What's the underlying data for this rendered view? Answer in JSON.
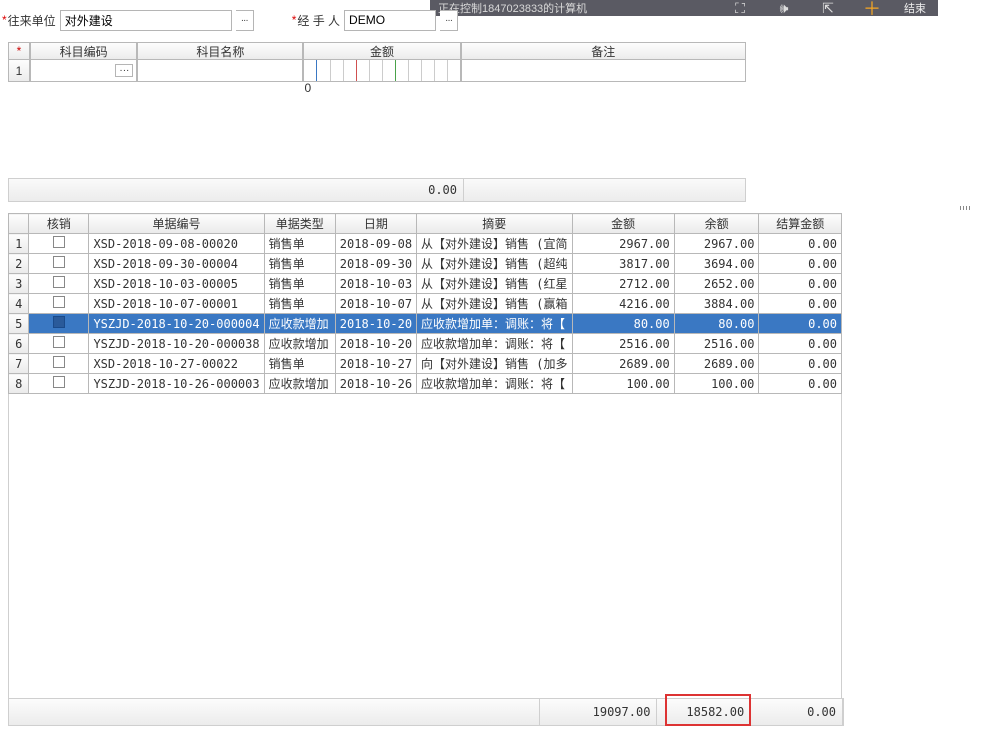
{
  "remote": {
    "title": "正在控制1847023833的计算机",
    "end_label": "结束"
  },
  "form": {
    "party_label": "往来单位",
    "party_value": "对外建设",
    "handler_label": "经 手 人",
    "handler_value": "DEMO"
  },
  "upper": {
    "headers": {
      "code": "科目编码",
      "name": "科目名称",
      "amount": "金额",
      "remark": "备注"
    },
    "row1_amount": "0",
    "footer_amount": "0.00"
  },
  "grid": {
    "headers": {
      "hx": "核销",
      "docno": "单据编号",
      "doctype": "单据类型",
      "date": "日期",
      "digest": "摘要",
      "amount": "金额",
      "balance": "余额",
      "settle": "结算金额"
    },
    "rows": [
      {
        "idx": "1",
        "doc": "XSD-2018-09-08-00020",
        "type": "销售单",
        "date": "2018-09-08",
        "digest": "从【对外建设】销售 (宜简",
        "amt": "2967.00",
        "bal": "2967.00",
        "settle": "0.00"
      },
      {
        "idx": "2",
        "doc": "XSD-2018-09-30-00004",
        "type": "销售单",
        "date": "2018-09-30",
        "digest": "从【对外建设】销售 (超纯",
        "amt": "3817.00",
        "bal": "3694.00",
        "settle": "0.00"
      },
      {
        "idx": "3",
        "doc": "XSD-2018-10-03-00005",
        "type": "销售单",
        "date": "2018-10-03",
        "digest": "从【对外建设】销售 (红星",
        "amt": "2712.00",
        "bal": "2652.00",
        "settle": "0.00"
      },
      {
        "idx": "4",
        "doc": "XSD-2018-10-07-00001",
        "type": "销售单",
        "date": "2018-10-07",
        "digest": "从【对外建设】销售 (赢箱",
        "amt": "4216.00",
        "bal": "3884.00",
        "settle": "0.00"
      },
      {
        "idx": "5",
        "doc": "YSZJD-2018-10-20-000004",
        "type": "应收款增加",
        "date": "2018-10-20",
        "digest": "应收款增加单：调账：将【",
        "amt": "80.00",
        "bal": "80.00",
        "settle": "0.00",
        "selected": true
      },
      {
        "idx": "6",
        "doc": "YSZJD-2018-10-20-000038",
        "type": "应收款增加",
        "date": "2018-10-20",
        "digest": "应收款增加单：调账：将【",
        "amt": "2516.00",
        "bal": "2516.00",
        "settle": "0.00"
      },
      {
        "idx": "7",
        "doc": "XSD-2018-10-27-00022",
        "type": "销售单",
        "date": "2018-10-27",
        "digest": "向【对外建设】销售 (加多",
        "amt": "2689.00",
        "bal": "2689.00",
        "settle": "0.00"
      },
      {
        "idx": "8",
        "doc": "YSZJD-2018-10-26-000003",
        "type": "应收款增加",
        "date": "2018-10-26",
        "digest": "应收款增加单：调账：将【",
        "amt": "100.00",
        "bal": "100.00",
        "settle": "0.00"
      }
    ],
    "totals": {
      "amount": "19097.00",
      "balance": "18582.00",
      "settle": "0.00"
    }
  }
}
